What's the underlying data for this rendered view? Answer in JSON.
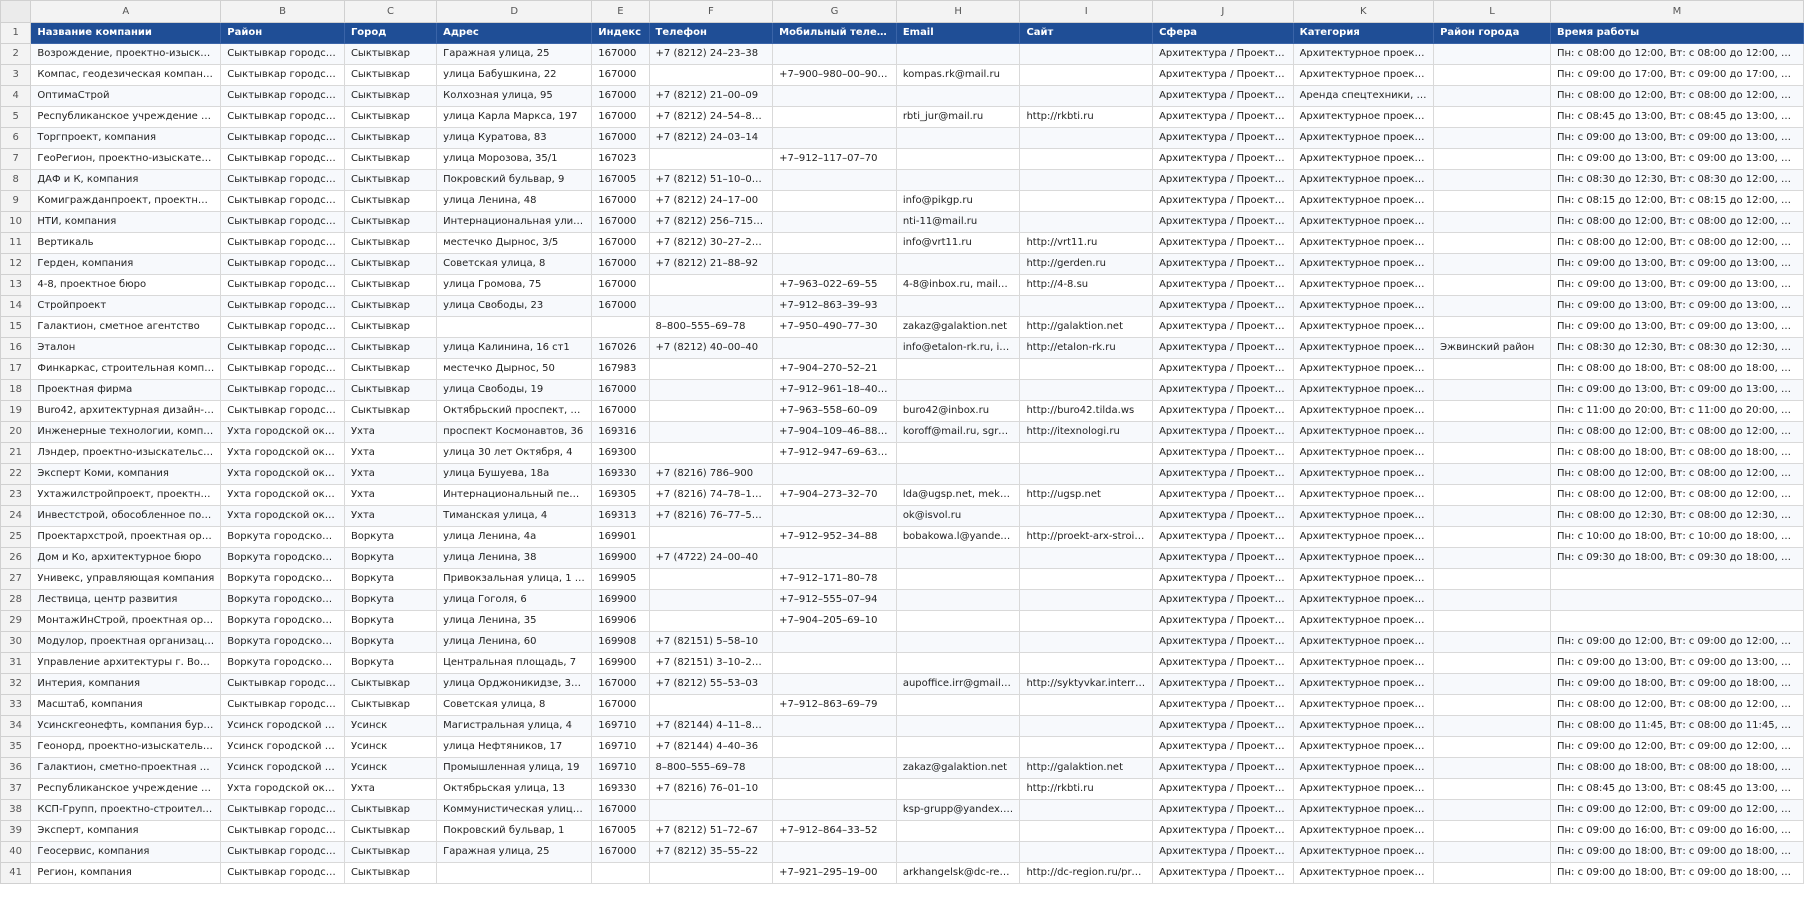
{
  "columns": [
    "A",
    "B",
    "C",
    "D",
    "E",
    "F",
    "G",
    "H",
    "I",
    "J",
    "K",
    "L",
    "M"
  ],
  "rows": [
    [
      "Название компании",
      "Район",
      "Город",
      "Адрес",
      "Индекс",
      "Телефон",
      "Мобильный телефон",
      "Email",
      "Сайт",
      "Сфера",
      "Категория",
      "Район города",
      "Время работы"
    ],
    [
      "Возрождение, проектно-изыскательск...",
      "Сыктывкар городской ...",
      "Сыктывкар",
      "Гаражная улица, 25",
      "167000",
      "+7 (8212) 24–23–38",
      "",
      "",
      "",
      "Архитектура / Проектиров...",
      "Архитектурное проектиро...",
      "",
      "Пн: с 08:00 до 12:00, Вт: с 08:00 до 12:00, С..."
    ],
    [
      "Компас, геодезическая компания",
      "Сыктывкар городской ...",
      "Сыктывкар",
      "улица Бабушкина, 22",
      "167000",
      "",
      "+7–900–980–00–90, +7...",
      "kompas.rk@mail.ru",
      "",
      "Архитектура / Проектиров...",
      "Архитектурное проектиро...",
      "",
      "Пн: с 09:00 до 17:00, Вт: с 09:00 до 17:00, С..."
    ],
    [
      "ОптимаСтрой",
      "Сыктывкар городской ...",
      "Сыктывкар",
      "Колхозная улица, 95",
      "167000",
      "+7 (8212) 21–00–09",
      "",
      "",
      "",
      "Архитектура / Проектиров...",
      "Аренда спецтехники, Архи...",
      "",
      "Пн: с 08:00 до 12:00, Вт: с 08:00 до 12:00, С..."
    ],
    [
      "Республиканское учреждение технич...",
      "Сыктывкар городской ...",
      "Сыктывкар",
      "улица Карла Маркса, 197",
      "167000",
      "+7 (8212) 24–54–81, +7...",
      "",
      "rbti_jur@mail.ru",
      "http://rkbti.ru",
      "Архитектура / Проектиров...",
      "Архитектурное проектиро...",
      "",
      "Пн: с 08:45 до 13:00, Вт: с 08:45 до 13:00, С..."
    ],
    [
      "Торгпроект, компания",
      "Сыктывкар городской ...",
      "Сыктывкар",
      "улица Куратова, 83",
      "167000",
      "+7 (8212) 24–03–14",
      "",
      "",
      "",
      "Архитектура / Проектиров...",
      "Архитектурное проектиро...",
      "",
      "Пн: с 09:00 до 13:00, Вт: с 09:00 до 13:00, С..."
    ],
    [
      "ГеоРегион, проектно-изыскательская ...",
      "Сыктывкар городской ...",
      "Сыктывкар",
      "улица Морозова, 35/1",
      "167023",
      "",
      "+7–912–117–07–70",
      "",
      "",
      "Архитектура / Проектиров...",
      "Архитектурное проектиро...",
      "",
      "Пн: с 09:00 до 13:00, Вт: с 09:00 до 13:00, С..."
    ],
    [
      "ДАФ и К, компания",
      "Сыктывкар городской ...",
      "Сыктывкар",
      "Покровский бульвар, 9",
      "167005",
      "+7 (8212) 51–10–02, +7...",
      "",
      "",
      "",
      "Архитектура / Проектиров...",
      "Архитектурное проектиро...",
      "",
      "Пн: с 08:30 до 12:30, Вт: с 08:30 до 12:00, С..."
    ],
    [
      "Комигражданпроект, проектный инст...",
      "Сыктывкар городской ...",
      "Сыктывкар",
      "улица Ленина, 48",
      "167000",
      "+7 (8212) 24–17–00",
      "",
      "info@pikgp.ru",
      "",
      "Архитектура / Проектиров...",
      "Архитектурное проектиро...",
      "",
      "Пн: с 08:15 до 12:00, Вт: с 08:15 до 12:00, С..."
    ],
    [
      "НТИ, компания",
      "Сыктывкар городской ...",
      "Сыктывкар",
      "Интернациональная улица, 131",
      "167000",
      "+7 (8212) 256–715, +7 (...",
      "",
      "nti-11@mail.ru",
      "",
      "Архитектура / Проектиров...",
      "Архитектурное проектиро...",
      "",
      "Пн: с 08:00 до 12:00, Вт: с 08:00 до 12:00, С..."
    ],
    [
      "Вертикаль",
      "Сыктывкар городской ...",
      "Сыктывкар",
      "местечко Дырнос, 3/5",
      "167000",
      "+7 (8212) 30–27–20, +7...",
      "",
      "info@vrt11.ru",
      "http://vrt11.ru",
      "Архитектура / Проектиров...",
      "Архитектурное проектиро...",
      "",
      "Пн: с 08:00 до 12:00, Вт: с 08:00 до 12:00, С..."
    ],
    [
      "Герден, компания",
      "Сыктывкар городской ...",
      "Сыктывкар",
      "Советская улица, 8",
      "167000",
      "+7 (8212) 21–88–92",
      "",
      "",
      "http://gerden.ru",
      "Архитектура / Проектиров...",
      "Архитектурное проектиро...",
      "",
      "Пн: с 09:00 до 13:00, Вт: с 09:00 до 13:00, С..."
    ],
    [
      "4-8, проектное бюро",
      "Сыктывкар городской ...",
      "Сыктывкар",
      "улица Громова, 75",
      "167000",
      "",
      "+7–963–022–69–55",
      "4-8@inbox.ru, mail@4-...",
      "http://4-8.su",
      "Архитектура / Проектиров...",
      "Архитектурное проектиро...",
      "",
      "Пн: с 09:00 до 13:00, Вт: с 09:00 до 13:00, С..."
    ],
    [
      "Стройпроект",
      "Сыктывкар городской ...",
      "Сыктывкар",
      "улица Свободы, 23",
      "167000",
      "",
      "+7–912–863–39–93",
      "",
      "",
      "Архитектура / Проектиров...",
      "Архитектурное проектиро...",
      "",
      "Пн: с 09:00 до 13:00, Вт: с 09:00 до 13:00, С..."
    ],
    [
      "Галактион, сметное агентство",
      "Сыктывкар городской ...",
      "Сыктывкар",
      "",
      "",
      "8–800–555–69–78",
      "+7–950–490–77–30",
      "zakaz@galaktion.net",
      "http://galaktion.net",
      "Архитектура / Проектиров...",
      "Архитектурное проектиро...",
      "",
      "Пн: с 09:00 до 13:00, Вт: с 09:00 до 13:00, С..."
    ],
    [
      "Эталон",
      "Сыктывкар городской ...",
      "Сыктывкар",
      "улица Калинина, 16 ст1",
      "167026",
      "+7 (8212) 40–00–40",
      "",
      "info@etalon-rk.ru, info...",
      "http://etalon-rk.ru",
      "Архитектура / Проектиров...",
      "Архитектурное проектиро...",
      "Эжвинский район",
      "Пн: с 08:30 до 12:30, Вт: с 08:30 до 12:30, С..."
    ],
    [
      "Финкаркас, строительная компания",
      "Сыктывкар городской ...",
      "Сыктывкар",
      "местечко Дырнос, 50",
      "167983",
      "",
      "+7–904–270–52–21",
      "",
      "",
      "Архитектура / Проектиров...",
      "Архитектурное проектиро...",
      "",
      "Пн: с 08:00 до 18:00, Вт: с 08:00 до 18:00, С..."
    ],
    [
      "Проектная фирма",
      "Сыктывкар городской ...",
      "Сыктывкар",
      "улица Свободы, 19",
      "167000",
      "",
      "+7–912–961–18–40, +7...",
      "",
      "",
      "Архитектура / Проектиров...",
      "Архитектурное проектиро...",
      "",
      "Пн: с 09:00 до 13:00, Вт: с 09:00 до 13:00, С..."
    ],
    [
      "Buro42, архитектурная дизайн-студия",
      "Сыктывкар городской ...",
      "Сыктывкар",
      "Октябрьский проспект, 131/4",
      "167000",
      "",
      "+7–963–558–60–09",
      "buro42@inbox.ru",
      "http://buro42.tilda.ws",
      "Архитектура / Проектиров...",
      "Архитектурное проектиро...",
      "",
      "Пн: с 11:00 до 20:00, Вт: с 11:00 до 20:00, С..."
    ],
    [
      "Инженерные технологии, компания",
      "Ухта городской округ",
      "Ухта",
      "проспект Космонавтов, 36",
      "169316",
      "",
      "+7–904–109–46–88, +7...",
      "koroff@mail.ru, sgreshn...",
      "http://itexnologi.ru",
      "Архитектура / Проектиров...",
      "Архитектурное проектиро...",
      "",
      "Пн: с 08:00 до 12:00, Вт: с 08:00 до 12:00, С..."
    ],
    [
      "Лэндер, проектно-изыскательский ин...",
      "Ухта городской округ",
      "Ухта",
      "улица 30 лет Октября, 4",
      "169300",
      "",
      "+7–912–947–69–63, +7...",
      "",
      "",
      "Архитектура / Проектиров...",
      "Архитектурное проектиро...",
      "",
      "Пн: с 08:00 до 18:00, Вт: с 08:00 до 18:00, С..."
    ],
    [
      "Эксперт Коми, компания",
      "Ухта городской округ",
      "Ухта",
      "улица Бушуева, 18а",
      "169330",
      "+7 (8216) 786–900",
      "",
      "",
      "",
      "Архитектура / Проектиров...",
      "Архитектурное проектиро...",
      "",
      "Пн: с 08:00 до 12:00, Вт: с 08:00 до 12:00, С..."
    ],
    [
      "Ухтажилстройпроект, проектно-строи...",
      "Ухта городской округ",
      "Ухта",
      "Интернациональный переуло...",
      "169305",
      "+7 (8216) 74–78–15, +7...",
      "+7–904–273–32–70",
      "lda@ugsp.net, mek@ug...",
      "http://ugsp.net",
      "Архитектура / Проектиров...",
      "Архитектурное проектиро...",
      "",
      "Пн: с 08:00 до 12:00, Вт: с 08:00 до 12:00, С..."
    ],
    [
      "Инвестстрой, обособленное подразд...",
      "Ухта городской округ",
      "Ухта",
      "Тиманская улица, 4",
      "169313",
      "+7 (8216) 76–77–50, +7...",
      "",
      "ok@isvol.ru",
      "",
      "Архитектура / Проектиров...",
      "Архитектурное проектиро...",
      "",
      "Пн: с 08:00 до 12:30, Вт: с 08:00 до 12:30, С..."
    ],
    [
      "Проектархстрой, проектная организа...",
      "Воркута городской ок...",
      "Воркута",
      "улица Ленина, 4а",
      "169901",
      "",
      "+7–912–952–34–88",
      "bobakowa.l@yandex.ru",
      "http://proekt-arx-stroi.ru",
      "Архитектура / Проектиров...",
      "Архитектурное проектиро...",
      "",
      "Пн: с 10:00 до 18:00, Вт: с 10:00 до 18:00, С..."
    ],
    [
      "Дом и Ко, архитектурное бюро",
      "Воркута городской ок...",
      "Воркута",
      "улица Ленина, 38",
      "169900",
      "+7 (4722) 24–00–40",
      "",
      "",
      "",
      "Архитектура / Проектиров...",
      "Архитектурное проектиро...",
      "",
      "Пн: с 09:30 до 18:00, Вт: с 09:30 до 18:00, С..."
    ],
    [
      "Унивекс, управляющая компания",
      "Воркута городской ок...",
      "Воркута",
      "Привокзальная улица, 1 ст1",
      "169905",
      "",
      "+7–912–171–80–78",
      "",
      "",
      "Архитектура / Проектиров...",
      "Архитектурное проектиро...",
      "",
      ""
    ],
    [
      "Лествица, центр развития",
      "Воркута городской ок...",
      "Воркута",
      "улица Гоголя, 6",
      "169900",
      "",
      "+7–912–555–07–94",
      "",
      "",
      "Архитектура / Проектиров...",
      "Архитектурное проектиро...",
      "",
      ""
    ],
    [
      "МонтажИнСтрой, проектная организ...",
      "Воркута городской ок...",
      "Воркута",
      "улица Ленина, 35",
      "169906",
      "",
      "+7–904–205–69–10",
      "",
      "",
      "Архитектура / Проектиров...",
      "Архитектурное проектиро...",
      "",
      ""
    ],
    [
      "Модулор, проектная организация",
      "Воркута городской ок...",
      "Воркута",
      "улица Ленина, 60",
      "169908",
      "+7 (82151) 5–58–10",
      "",
      "",
      "",
      "Архитектура / Проектиров...",
      "Архитектурное проектиро...",
      "",
      "Пн: с 09:00 до 12:00, Вт: с 09:00 до 12:00, С..."
    ],
    [
      "Управление архитектуры г. Воркуты",
      "Воркута городской ок...",
      "Воркута",
      "Центральная площадь, 7",
      "169900",
      "+7 (82151) 3–10–27, +7...",
      "",
      "",
      "",
      "Архитектура / Проектиров...",
      "Архитектурное проектиро...",
      "",
      "Пн: с 09:00 до 13:00, Вт: с 09:00 до 13:00, С..."
    ],
    [
      "Интерия, компания",
      "Сыктывкар городской ...",
      "Сыктывкар",
      "улица Орджоникидзе, 33/45",
      "167000",
      "+7 (8212) 55–53–03",
      "",
      "aupoffice.irr@gmail.co...",
      "http://syktyvkar.interriya.ru/",
      "Архитектура / Проектиров...",
      "Архитектурное проектиро...",
      "",
      "Пн: с 09:00 до 18:00, Вт: с 09:00 до 18:00, С..."
    ],
    [
      "Масштаб, компания",
      "Сыктывкар городской ...",
      "Сыктывкар",
      "Советская улица, 8",
      "167000",
      "",
      "+7–912–863–69–79",
      "",
      "",
      "Архитектура / Проектиров...",
      "Архитектурное проектиро...",
      "",
      "Пн: с 08:00 до 12:00, Вт: с 08:00 до 12:00, С..."
    ],
    [
      "Усинскгеонефть, компания буровых и...",
      "Усинск городской округ",
      "Усинск",
      "Магистральная улица, 4",
      "169710",
      "+7 (82144) 4–11–86, +7...",
      "",
      "",
      "",
      "Архитектура / Проектиров...",
      "Архитектурное проектиро...",
      "",
      "Пн: с 08:00 до 11:45, Вт: с 08:00 до 11:45, С..."
    ],
    [
      "Геонорд, проектно-изыскательная ко...",
      "Усинск городской округ",
      "Усинск",
      "улица Нефтяников, 17",
      "169710",
      "+7 (82144) 4–40–36",
      "",
      "",
      "",
      "Архитектура / Проектиров...",
      "Архитектурное проектиро...",
      "",
      "Пн: с 09:00 до 12:00, Вт: с 09:00 до 12:00, С..."
    ],
    [
      "Галактион, сметно-проектная органи...",
      "Усинск городской округ",
      "Усинск",
      "Промышленная улица, 19",
      "169710",
      "8–800–555–69–78",
      "",
      "zakaz@galaktion.net",
      "http://galaktion.net",
      "Архитектура / Проектиров...",
      "Архитектурное проектиро...",
      "",
      "Пн: с 08:00 до 18:00, Вт: с 08:00 до 18:00, С..."
    ],
    [
      "Республиканское учреждение технич...",
      "Ухта городской округ",
      "Ухта",
      "Октябрьская улица, 13",
      "169330",
      "+7 (8216) 76–01–10",
      "",
      "",
      "http://rkbti.ru",
      "Архитектура / Проектиров...",
      "Архитектурное проектиро...",
      "",
      "Пн: с 08:45 до 13:00, Вт: с 08:45 до 13:00, С..."
    ],
    [
      "КСП-Групп, проектно-строительная к...",
      "Сыктывкар городской ...",
      "Сыктывкар",
      "Коммунистическая улица, 21/1",
      "167000",
      "",
      "",
      "ksp-grupp@yandex.ru",
      "",
      "Архитектура / Проектиров...",
      "Архитектурное проектиро...",
      "",
      "Пн: с 09:00 до 12:00, Вт: с 09:00 до 12:00, С..."
    ],
    [
      "Эксперт, компания",
      "Сыктывкар городской ...",
      "Сыктывкар",
      "Покровский бульвар, 1",
      "167005",
      "+7 (8212) 51–72–67",
      "+7–912–864–33–52",
      "",
      "",
      "Архитектура / Проектиров...",
      "Архитектурное проектиро...",
      "",
      "Пн: с 09:00 до 16:00, Вт: с 09:00 до 16:00, С..."
    ],
    [
      "Геосервис, компания",
      "Сыктывкар городской ...",
      "Сыктывкар",
      "Гаражная улица, 25",
      "167000",
      "+7 (8212) 35–55–22",
      "",
      "",
      "",
      "Архитектура / Проектиров...",
      "Архитектурное проектиро...",
      "",
      "Пн: с 09:00 до 18:00, Вт: с 09:00 до 18:00, С..."
    ],
    [
      "Регион, компания",
      "Сыктывкар городской ...",
      "Сыктывкар",
      "",
      "",
      "",
      "+7–921–295–19–00",
      "arkhangelsk@dc-region...",
      "http://dc-region.ru/proekt...",
      "Архитектура / Проектиров...",
      "Архитектурное проектиро...",
      "",
      "Пн: с 09:00 до 18:00, Вт: с 09:00 до 18:00, С..."
    ]
  ]
}
